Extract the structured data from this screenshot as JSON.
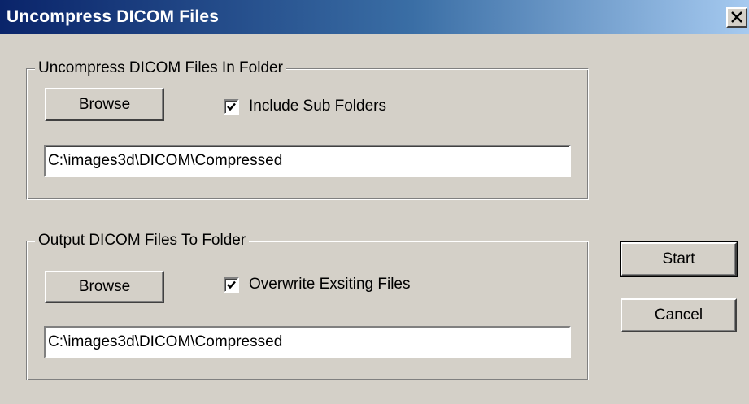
{
  "window": {
    "title": "Uncompress DICOM Files",
    "close_icon": "close-icon"
  },
  "input_group": {
    "legend": "Uncompress DICOM Files In Folder",
    "browse_label": "Browse",
    "checkbox_label": "Include Sub Folders",
    "checkbox_checked": true,
    "path_value": "C:\\images3d\\DICOM\\Compressed"
  },
  "output_group": {
    "legend": "Output DICOM Files To Folder",
    "browse_label": "Browse",
    "checkbox_label": "Overwrite Exsiting Files",
    "checkbox_checked": true,
    "path_value": "C:\\images3d\\DICOM\\Compressed"
  },
  "actions": {
    "start_label": "Start",
    "cancel_label": "Cancel"
  },
  "colors": {
    "dialog_bg": "#d4d0c8",
    "titlebar_start": "#0a246a",
    "titlebar_end": "#a6caf0"
  }
}
